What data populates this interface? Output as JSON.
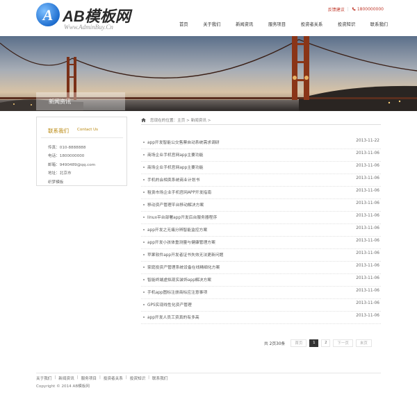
{
  "header": {
    "logo_mark": "A",
    "logo_text": "AB模板网",
    "logo_sub": "Www.AdminBuy.Cn",
    "feedback": "反馈建议",
    "phone": "1800000000",
    "nav": [
      "首页",
      "关于我们",
      "新闻资讯",
      "服务项目",
      "投资者关系",
      "投资知识",
      "联系我们"
    ]
  },
  "banner": {
    "label": "新闻资讯"
  },
  "sidebar": {
    "title": "联系我们",
    "title_en": "Contact Us",
    "lines": [
      "传真：010-8888888",
      "电话：1800000000",
      "邮箱：9490489@qq.com",
      "地址：北京市",
      "织梦模板"
    ]
  },
  "breadcrumb": {
    "text": "您现在的位置：主页 > 新闻资讯 >"
  },
  "news": [
    {
      "title": "app开发智能公交售票自动系统需求调研",
      "date": "2013-11-22"
    },
    {
      "title": "商场企业手机官网app主要功能",
      "date": "2013-11-06"
    },
    {
      "title": "商场企业手机官网app主要功能",
      "date": "2013-11-06"
    },
    {
      "title": "手机的会相卖系统商业计划书",
      "date": "2013-11-06"
    },
    {
      "title": "租赁市场企业手机官网APP开发指南",
      "date": "2013-11-06"
    },
    {
      "title": "移动资产管理平台移动解决方案",
      "date": "2013-11-06"
    },
    {
      "title": "linux平台部署app开发后台服务器程序",
      "date": "2013-11-06"
    },
    {
      "title": "app开发之无痛分辨智能监控方案",
      "date": "2013-11-06"
    },
    {
      "title": "app开发小孩体重测量与健康管理方案",
      "date": "2013-11-06"
    },
    {
      "title": "苹果软件app开发者证书失效无法更新问题",
      "date": "2013-11-06"
    },
    {
      "title": "家庭投资产管理系统设备在线精细化方案",
      "date": "2013-11-06"
    },
    {
      "title": "智能终端虚拟现实装饰app解决方案",
      "date": "2013-11-06"
    },
    {
      "title": "手机app图标注册商标应注意事项",
      "date": "2013-11-06"
    },
    {
      "title": "GPS实现线性化资产管理",
      "date": "2013-11-06"
    },
    {
      "title": "app开发人员工资真的有多高",
      "date": "2013-11-06"
    }
  ],
  "pagination": {
    "info": "共 2页30条",
    "first": "首页",
    "pages": [
      "1",
      "2"
    ],
    "next": "下一页",
    "last": "末页"
  },
  "footer": {
    "links": [
      "关于我们",
      "新闻资讯",
      "服务项目",
      "投资者关系",
      "投资知识",
      "联系我们"
    ],
    "copyright": "Copyright © 2014 AB模板网"
  }
}
